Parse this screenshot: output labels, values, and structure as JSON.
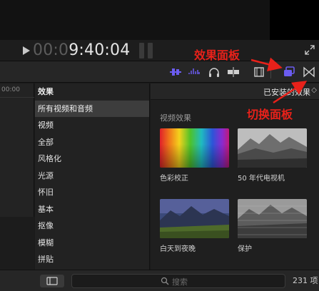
{
  "viewer": {
    "timecode_dim": "00:0",
    "timecode_bright": "9:40:04"
  },
  "timeline": {
    "ruler_text": "00:00"
  },
  "sidebar": {
    "header": "效果",
    "items": [
      {
        "label": "所有视频和音频",
        "selected": true
      },
      {
        "label": "视频",
        "section": true
      },
      {
        "label": "全部"
      },
      {
        "label": "风格化"
      },
      {
        "label": "光源"
      },
      {
        "label": "怀旧"
      },
      {
        "label": "基本"
      },
      {
        "label": "抠像"
      },
      {
        "label": "模糊"
      },
      {
        "label": "拼贴"
      }
    ]
  },
  "browser": {
    "installed_label": "已安装的效果",
    "section_title": "视频效果",
    "effects": [
      {
        "label": "色彩校正",
        "icon": "color-bars-thumbnail"
      },
      {
        "label": "50 年代电视机",
        "icon": "bw-mountain-thumbnail"
      },
      {
        "label": "白天到夜晚",
        "icon": "dusk-mountain-thumbnail"
      },
      {
        "label": "保护",
        "icon": "noisy-mountain-thumbnail"
      }
    ]
  },
  "bottom": {
    "search_placeholder": "搜索",
    "item_count": "231 项"
  },
  "annotations": {
    "effects_browser": "效果面板",
    "transitions_browser": "切换面板"
  },
  "colors": {
    "accent_purple": "#6b5cf0",
    "annotation_red": "#e8211a"
  }
}
